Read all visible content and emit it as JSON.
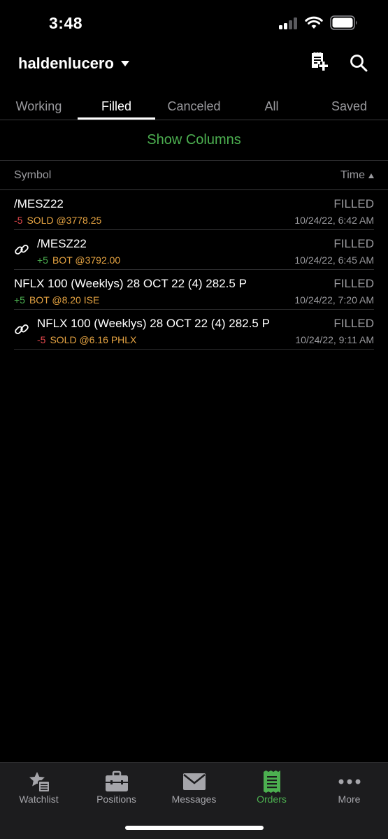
{
  "status_bar": {
    "time": "3:48"
  },
  "header": {
    "account_name": "haldenlucero"
  },
  "tabs": [
    {
      "label": "Working"
    },
    {
      "label": "Filled"
    },
    {
      "label": "Canceled"
    },
    {
      "label": "All"
    },
    {
      "label": "Saved"
    }
  ],
  "active_tab": "Filled",
  "show_columns_label": "Show Columns",
  "columns": {
    "symbol": "Symbol",
    "time": "Time"
  },
  "orders": [
    {
      "symbol": "/MESZ22",
      "qty": "-5",
      "fill": "SOLD @3778.25",
      "status": "FILLED",
      "time": "10/24/22, 6:42 AM",
      "linked": false
    },
    {
      "symbol": "/MESZ22",
      "qty": "+5",
      "fill": "BOT @3792.00",
      "status": "FILLED",
      "time": "10/24/22, 6:45 AM",
      "linked": true
    },
    {
      "symbol": "NFLX 100 (Weeklys) 28 OCT 22 (4) 282.5 P",
      "qty": "+5",
      "fill": "BOT @8.20 ISE",
      "status": "FILLED",
      "time": "10/24/22, 7:20 AM",
      "linked": false
    },
    {
      "symbol": "NFLX 100 (Weeklys) 28 OCT 22 (4) 282.5 P",
      "qty": "-5",
      "fill": "SOLD @6.16 PHLX",
      "status": "FILLED",
      "time": "10/24/22, 9:11 AM",
      "linked": true
    }
  ],
  "tabbar": [
    {
      "label": "Watchlist",
      "icon": "star-list-icon"
    },
    {
      "label": "Positions",
      "icon": "briefcase-icon"
    },
    {
      "label": "Messages",
      "icon": "envelope-icon"
    },
    {
      "label": "Orders",
      "icon": "receipt-icon"
    },
    {
      "label": "More",
      "icon": "more-dots-icon"
    }
  ],
  "active_tabbar": "Orders",
  "colors": {
    "accent_green": "#4caf50",
    "negative_red": "#e5484d",
    "fill_orange": "#e6a442",
    "muted_gray": "#9b9b9f"
  }
}
